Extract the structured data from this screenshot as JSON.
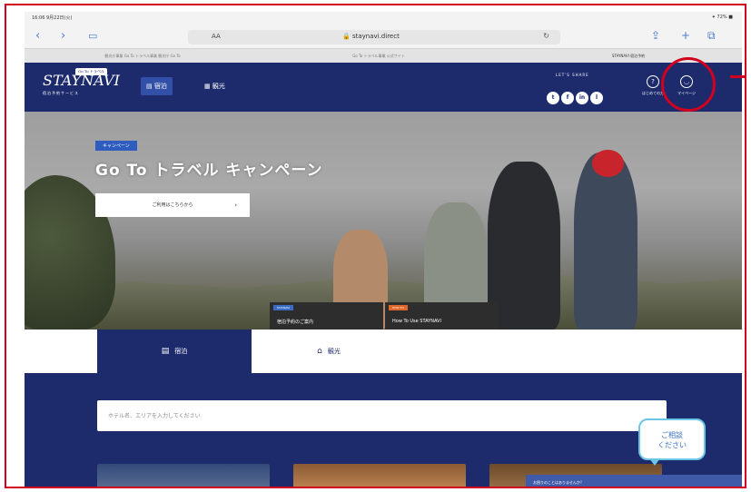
{
  "status_bar": {
    "time": "16:06 9月22日(火)",
    "battery": "✦ 72% ■"
  },
  "safari": {
    "aa": "AA",
    "url": "🔒 staynavi.direct",
    "reload": "↻",
    "tabs": [
      "観光庁事業 Go To トラベル事業 観光庁 Go To",
      "Go To トラベル事業 公式サイト",
      "STAYNAVI 宿泊予約"
    ]
  },
  "site": {
    "logo": "STAYNAVI",
    "logo_badge": "Go To トラベル",
    "logo_sub": "宿泊予約サービス",
    "nav_stay": "宿泊",
    "nav_sight": "観光",
    "share_label": "LET'S SHARE",
    "social": [
      "t",
      "f",
      "in",
      "l"
    ],
    "link_guide": "はじめての方",
    "link_mypage": "マイページ"
  },
  "hero": {
    "tag": "キャンペーン",
    "title": "Go To トラベル キャンペーン",
    "cta": "ご利用はこちらから",
    "thumb1_label": "STAYNAVI",
    "thumb1_caption": "宿泊予約のご案内",
    "thumb2_label": "HOW TO",
    "thumb2_caption": "How To Use STAYNAVI"
  },
  "booking": {
    "tab_stay": "宿泊",
    "tab_sight": "観光",
    "search_placeholder": "ホテル名、エリアを入力してください"
  },
  "chat": {
    "line1": "ご相談",
    "line2": "ください",
    "bar": "お困りのことはありませんか？"
  }
}
